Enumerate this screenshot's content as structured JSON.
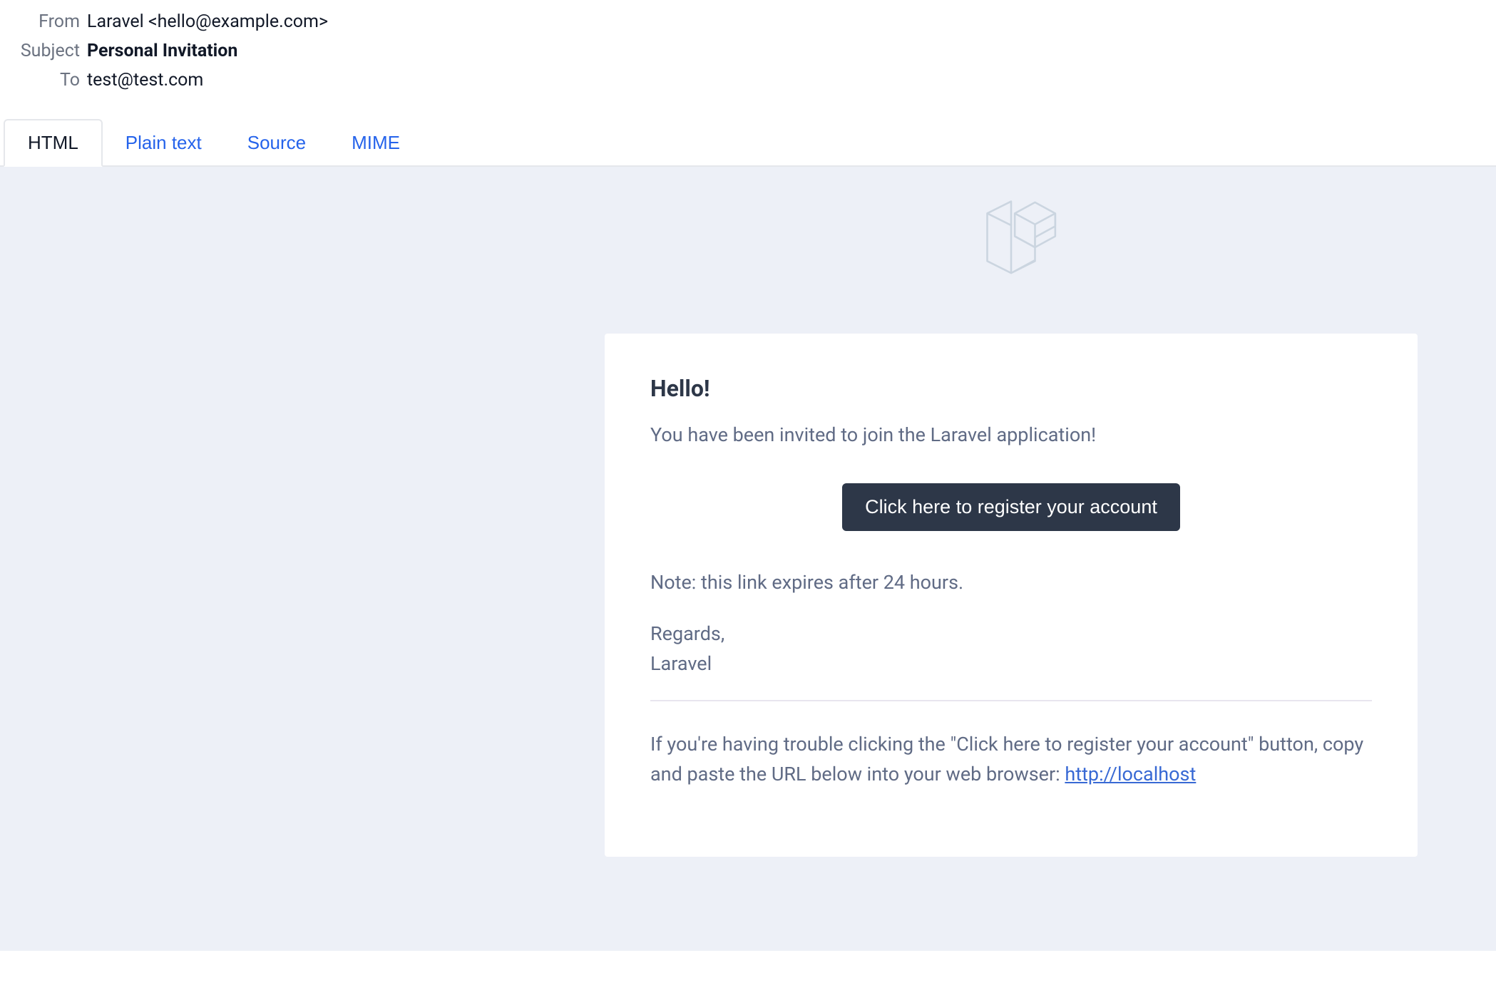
{
  "headers": {
    "from": {
      "label": "From",
      "value": "Laravel <hello@example.com>"
    },
    "subject": {
      "label": "Subject",
      "value": "Personal Invitation"
    },
    "to": {
      "label": "To",
      "value": "test@test.com"
    }
  },
  "tabs": {
    "html": "HTML",
    "plain": "Plain text",
    "source": "Source",
    "mime": "MIME"
  },
  "email": {
    "greeting": "Hello!",
    "intro": "You have been invited to join the Laravel application!",
    "button_label": "Click here to register your account",
    "note": "Note: this link expires after 24 hours.",
    "signoff": "Regards,\nLaravel",
    "subcopy_text": "If you're having trouble clicking the \"Click here to register your account\" button, copy and paste the URL below into your web browser: ",
    "subcopy_link": "http://localhost"
  },
  "colors": {
    "tab_link": "#2563eb",
    "button_bg": "#2d3748",
    "preview_bg": "#edf0f7",
    "link": "#3869d4"
  }
}
